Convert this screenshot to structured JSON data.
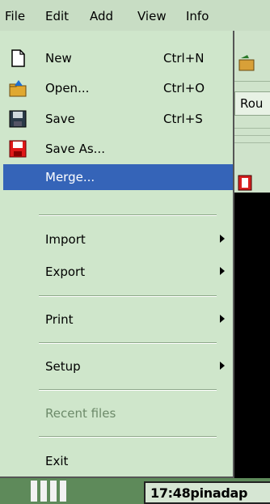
{
  "menubar": {
    "items": [
      {
        "label": "File"
      },
      {
        "label": "Edit"
      },
      {
        "label": "Add"
      },
      {
        "label": "View"
      },
      {
        "label": "Info"
      }
    ]
  },
  "file_menu": {
    "new": {
      "label": "New",
      "shortcut": "Ctrl+N",
      "icon": "new-document-icon"
    },
    "open": {
      "label": "Open...",
      "shortcut": "Ctrl+O",
      "icon": "open-folder-icon"
    },
    "save": {
      "label": "Save",
      "shortcut": "Ctrl+S",
      "icon": "floppy-disk-icon"
    },
    "save_as": {
      "label": "Save As...",
      "icon": "red-floppy-disk-icon"
    },
    "merge": {
      "label": "Merge...",
      "selected": true
    },
    "import": {
      "label": "Import"
    },
    "export": {
      "label": "Export"
    },
    "print": {
      "label": "Print"
    },
    "setup": {
      "label": "Setup"
    },
    "recent_files": {
      "label": "Recent files",
      "disabled": true
    },
    "exit": {
      "label": "Exit"
    }
  },
  "background": {
    "route_label": "Rou",
    "status_text": "17:48pinadap"
  },
  "colors": {
    "menu_bg": "#cfe6cb",
    "selection": "#3564b8",
    "disabled_text": "#6d8a6a"
  }
}
